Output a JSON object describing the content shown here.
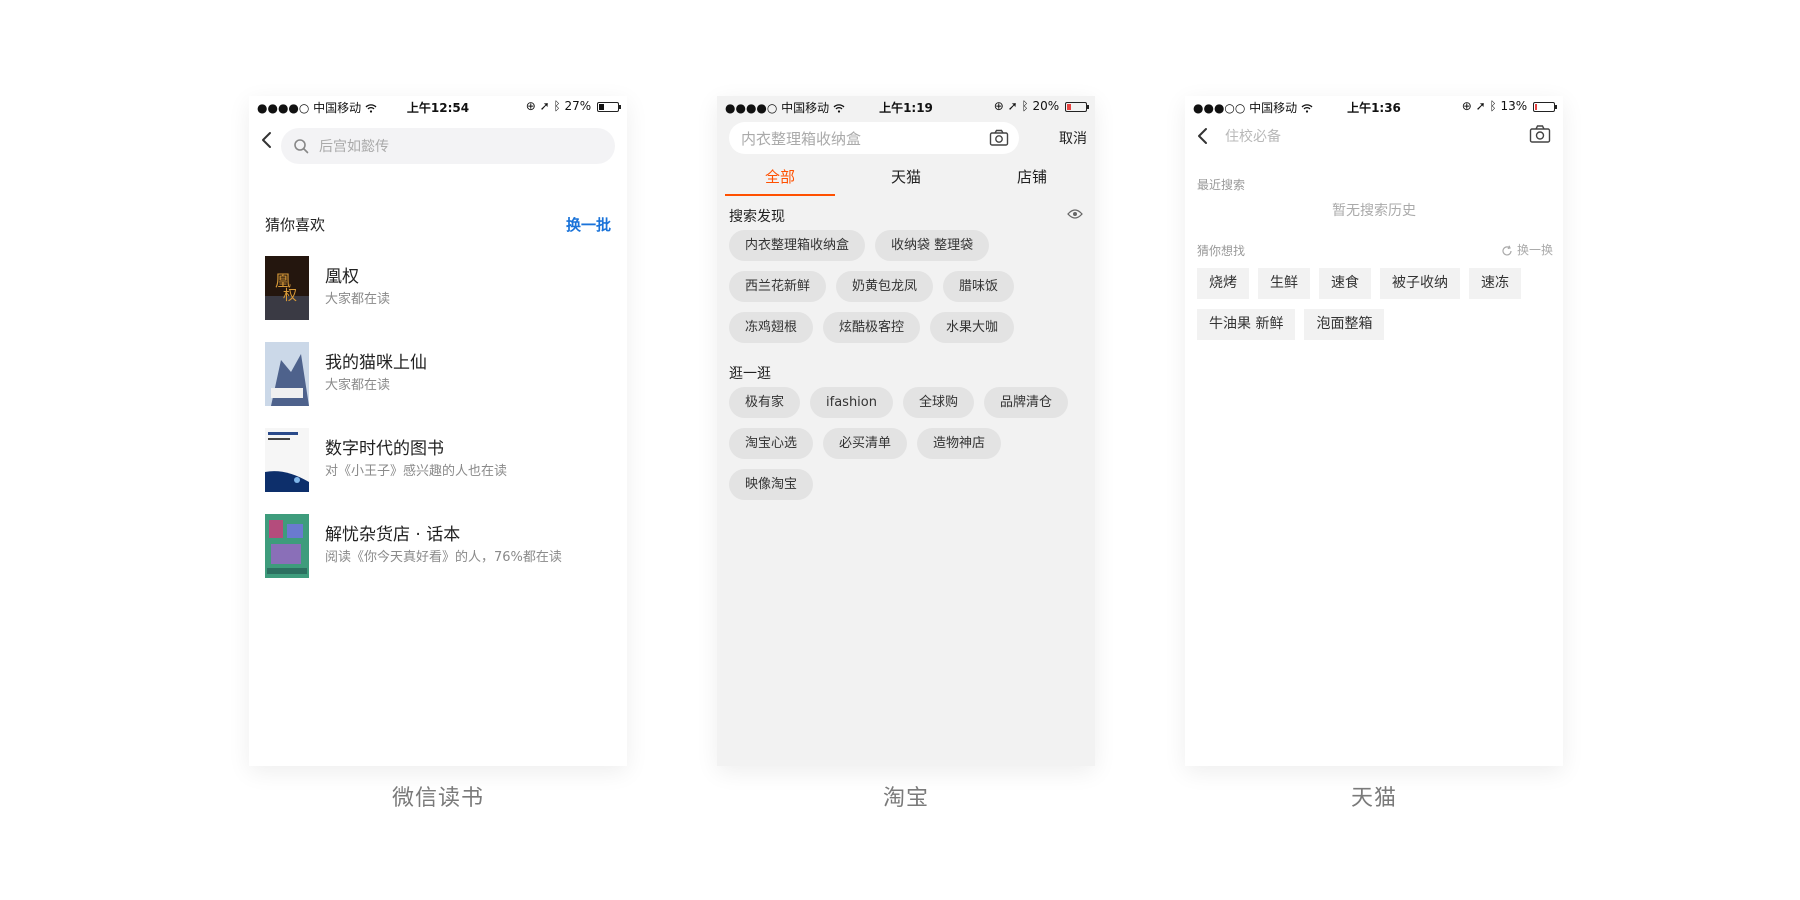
{
  "panels": {
    "wechat_read": {
      "caption": "微信读书",
      "status": {
        "carrier": "●●●●○ 中国移动",
        "time": "上午12:54",
        "battery": "27%",
        "battery_level": 0.27
      },
      "search": {
        "placeholder": "后宫如懿传"
      },
      "section": {
        "title": "猜你喜欢",
        "refresh": "换一批"
      },
      "books": [
        {
          "title": "凰权",
          "subtitle": "大家都在读",
          "cover_colors": [
            "#2a1a10",
            "#c8882c"
          ]
        },
        {
          "title": "我的猫咪上仙",
          "subtitle": "大家都在读",
          "cover_colors": [
            "#c9d6e6",
            "#4b5f88"
          ]
        },
        {
          "title": "数字时代的图书",
          "subtitle": "对《小王子》感兴趣的人也在读",
          "cover_colors": [
            "#f7f7f7",
            "#0c2f6a"
          ]
        },
        {
          "title": "解忧杂货店 · 话本",
          "subtitle": "阅读《你今天真好看》的人，76%都在读",
          "cover_colors": [
            "#3c9a7b",
            "#b24a7a"
          ]
        }
      ]
    },
    "taobao": {
      "caption": "淘宝",
      "status": {
        "carrier": "●●●●○ 中国移动",
        "time": "上午1:19",
        "battery": "20%",
        "battery_level": 0.2
      },
      "search": {
        "placeholder": "内衣整理箱收纳盒",
        "cancel": "取消"
      },
      "tabs": [
        "全部",
        "天猫",
        "店铺"
      ],
      "active_tab": 0,
      "discover": {
        "title": "搜索发现",
        "tags": [
          "内衣整理箱收纳盒",
          "收纳袋 整理袋",
          "西兰花新鲜",
          "奶黄包龙凤",
          "腊味饭",
          "冻鸡翅根",
          "炫酷极客控",
          "水果大咖"
        ]
      },
      "browse": {
        "title": "逛一逛",
        "tags": [
          "极有家",
          "ifashion",
          "全球购",
          "品牌清仓",
          "淘宝心选",
          "必买清单",
          "造物神店",
          "映像淘宝"
        ]
      },
      "accent_color": "#ff5000"
    },
    "tmall": {
      "caption": "天猫",
      "status": {
        "carrier": "●●●○○ 中国移动",
        "time": "上午1:36",
        "battery": "13%",
        "battery_level": 0.13
      },
      "search": {
        "placeholder": "住校必备"
      },
      "recent": {
        "title": "最近搜索",
        "empty": "暂无搜索历史"
      },
      "suggest": {
        "title": "猜你想找",
        "refresh": "换一换",
        "tags": [
          "烧烤",
          "生鲜",
          "速食",
          "被子收纳",
          "速冻",
          "牛油果 新鲜",
          "泡面整箱"
        ]
      }
    }
  }
}
